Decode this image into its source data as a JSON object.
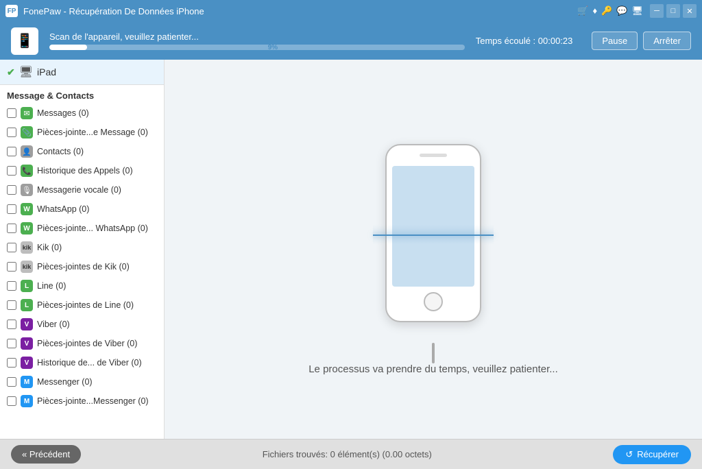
{
  "titleBar": {
    "icon": "FP",
    "title": "FonePaw - Récupération De Données iPhone",
    "controls": [
      "minimize",
      "maximize",
      "close"
    ],
    "topIcons": [
      "cart",
      "diamond",
      "key",
      "chat",
      "monitor"
    ]
  },
  "scanBar": {
    "deviceIcon": "📱",
    "scanText": "Scan de l'appareil, veuillez patienter...",
    "progress": 9,
    "progressLabel": "9%",
    "timeLabel": "Temps écoulé : 00:00:23",
    "pauseLabel": "Pause",
    "stopLabel": "Arrêter"
  },
  "sidebar": {
    "deviceName": "iPad",
    "sectionHeader": "Message & Contacts",
    "items": [
      {
        "label": "Messages (0)",
        "iconType": "messages",
        "iconChar": "✉"
      },
      {
        "label": "Pièces-jointe...e Message (0)",
        "iconType": "attachment",
        "iconChar": "📎"
      },
      {
        "label": "Contacts (0)",
        "iconType": "contacts",
        "iconChar": "👤"
      },
      {
        "label": "Historique des Appels (0)",
        "iconType": "calls",
        "iconChar": "📞"
      },
      {
        "label": "Messagerie vocale (0)",
        "iconType": "voicemail",
        "iconChar": "🎙"
      },
      {
        "label": "WhatsApp (0)",
        "iconType": "whatsapp",
        "iconChar": "W"
      },
      {
        "label": "Pièces-jointe... WhatsApp (0)",
        "iconType": "whatsapp",
        "iconChar": "W"
      },
      {
        "label": "Kik (0)",
        "iconType": "kik",
        "iconChar": "K"
      },
      {
        "label": "Pièces-jointes de Kik (0)",
        "iconType": "kik",
        "iconChar": "K"
      },
      {
        "label": "Line (0)",
        "iconType": "line",
        "iconChar": "L"
      },
      {
        "label": "Pièces-jointes de Line (0)",
        "iconType": "line",
        "iconChar": "L"
      },
      {
        "label": "Viber (0)",
        "iconType": "viber",
        "iconChar": "V"
      },
      {
        "label": "Pièces-jointes de Viber (0)",
        "iconType": "viber",
        "iconChar": "V"
      },
      {
        "label": "Historique de... de Viber (0)",
        "iconType": "viber",
        "iconChar": "V"
      },
      {
        "label": "Messenger (0)",
        "iconType": "messenger",
        "iconChar": "M"
      },
      {
        "label": "Pièces-jointe...Messenger (0)",
        "iconType": "messenger",
        "iconChar": "M"
      }
    ]
  },
  "rightPanel": {
    "scanMessage": "Le processus va prendre du temps, veuillez patienter..."
  },
  "footer": {
    "backLabel": "« Précédent",
    "statusLabel": "Fichiers trouvés: 0 élément(s) (0.00  octets)",
    "recoverLabel": "Récupérer"
  }
}
